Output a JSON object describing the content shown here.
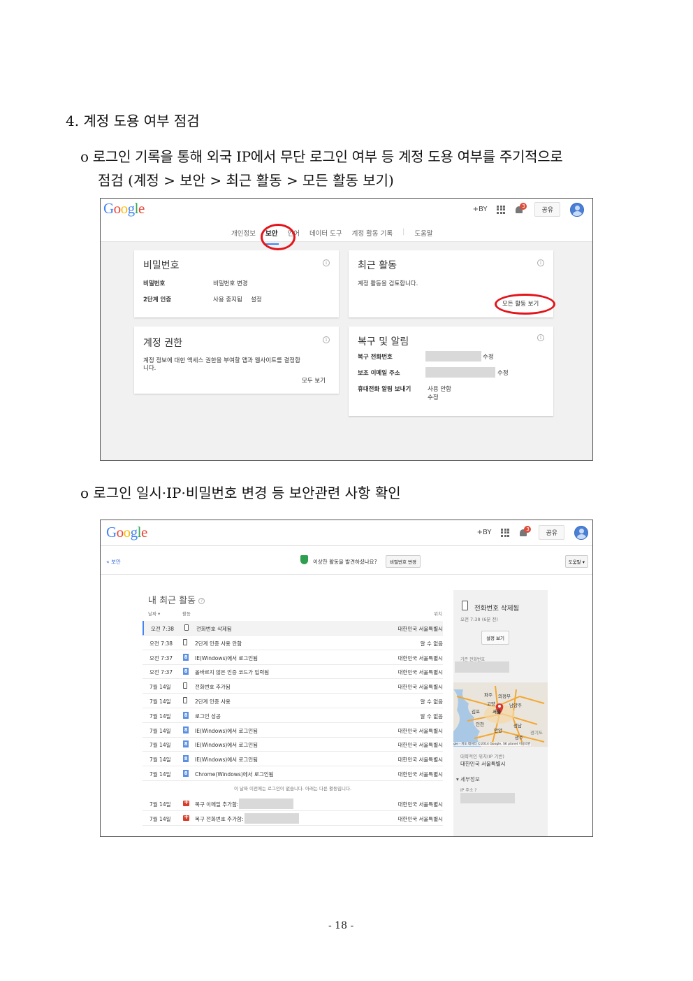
{
  "doc": {
    "heading": "4. 계정 도용 여부 점검",
    "bullet1_line1": "o 로그인 기록을 통해 외국 IP에서 무단 로그인 여부 등 계정 도용 여부를 주기적으로",
    "bullet1_line2": "점검 (계정 > 보안 > 최근 활동 > 모든 활동 보기)",
    "bullet2": "o 로그인 일시·IP·비밀번호 변경 등 보안관련 사항 확인",
    "page_number": "- 18 -"
  },
  "shot1": {
    "topbar": {
      "plus": "+BY",
      "notif_count": "3",
      "share": "공유"
    },
    "tabs": [
      "개인정보",
      "보안",
      "언어",
      "데이터 도구",
      "계정 활동 기록",
      "도움말"
    ],
    "password_card": {
      "title": "비밀번호",
      "row1_label": "비밀번호",
      "row1_value": "비밀번호 변경",
      "row2_label": "2단계 인증",
      "row2_value": "사용 중지됨",
      "row2_link": "설정"
    },
    "recent_card": {
      "title": "최근 활동",
      "desc": "계정 활동을 검토합니다.",
      "link": "모든 활동 보기"
    },
    "permission_card": {
      "title": "계정 권한",
      "desc_line1": "계정 정보에 대한 액세스 권한을 부여할 앱과 웹사이트를 결정합",
      "desc_line2": "니다.",
      "link": "모두 보기"
    },
    "recovery_card": {
      "title": "복구 및 알림",
      "phone_label": "복구 전화번호",
      "phone_link": "수정",
      "email_label": "보조 이메일 주소",
      "email_link": "수정",
      "alert_label": "휴대전화 알림 보내기",
      "alert_value": "사용 안함",
      "alert_link": "수정"
    }
  },
  "shot2": {
    "topbar": {
      "plus": "+BY",
      "notif_count": "3",
      "share": "공유"
    },
    "back_link": "« 보안",
    "suspicious_text": "이상한 활동을 발견하셨나요?",
    "change_pw_button": "비밀번호 변경",
    "help_button": "도움말 ▾",
    "title": "내 최근 활동",
    "col_date": "날짜 ▾",
    "col_activity": "활동",
    "col_location": "위치",
    "rows": [
      {
        "date": "오전 7:38",
        "icon": "phone",
        "activity": "전화번호 삭제됨",
        "location": "대한민국 서울특별시"
      },
      {
        "date": "오전 7:38",
        "icon": "phone",
        "activity": "2단계 인증 사용 안함",
        "location": "알 수 없음"
      },
      {
        "date": "오전 7:37",
        "icon": "g",
        "activity": "IE(Windows)에서 로그인됨",
        "location": "대한민국 서울특별시"
      },
      {
        "date": "오전 7:37",
        "icon": "g",
        "activity": "올바르지 않은 인증 코드가 입력됨",
        "location": "대한민국 서울특별시"
      },
      {
        "date": "7월 14일",
        "icon": "phone",
        "activity": "전화번호 추가됨",
        "location": "대한민국 서울특별시"
      },
      {
        "date": "7월 14일",
        "icon": "phone",
        "activity": "2단계 인증 사용",
        "location": "알 수 없음"
      },
      {
        "date": "7월 14일",
        "icon": "g",
        "activity": "로그인 성공",
        "location": "알 수 없음"
      },
      {
        "date": "7월 14일",
        "icon": "g",
        "activity": "IE(Windows)에서 로그인됨",
        "location": "대한민국 서울특별시"
      },
      {
        "date": "7월 14일",
        "icon": "g",
        "activity": "IE(Windows)에서 로그인됨",
        "location": "대한민국 서울특별시"
      },
      {
        "date": "7월 14일",
        "icon": "g",
        "activity": "IE(Windows)에서 로그인됨",
        "location": "대한민국 서울특별시"
      },
      {
        "date": "7월 14일",
        "icon": "g",
        "activity": "Chrome(Windows)에서 로그인됨",
        "location": "대한민국 서울특별시"
      }
    ],
    "notice": "이 날짜 이전에는 로그인이 없습니다. 아래는 다른 활동입니다.",
    "rows2": [
      {
        "date": "7월 14일",
        "icon": "kit",
        "activity": "복구 이메일 추가함:",
        "location": "대한민국 서울특별시"
      },
      {
        "date": "7월 14일",
        "icon": "kit",
        "activity": "복구 전화번호 추가함:",
        "location": "대한민국 서울특별시"
      }
    ],
    "side": {
      "title": "전화번호 삭제됨",
      "time": "오전 7:38 (6분 전)",
      "settings_button": "설정 보기",
      "prev_phone_label": "기존 전화번호",
      "map_labels": [
        "파주",
        "의정부",
        "고양",
        "남양주",
        "김포",
        "서울",
        "인천",
        "성남",
        "안양",
        "광주",
        "경기도"
      ],
      "map_credit": "gle - 지도 데이터 ©2014 Google, SK planet   이용약관",
      "approx_label": "대략적인 위치(IP 기반)",
      "approx_value": "대한민국 서울특별시",
      "details": "▾ 세부정보",
      "ip_label": "IP 주소 ?"
    }
  }
}
